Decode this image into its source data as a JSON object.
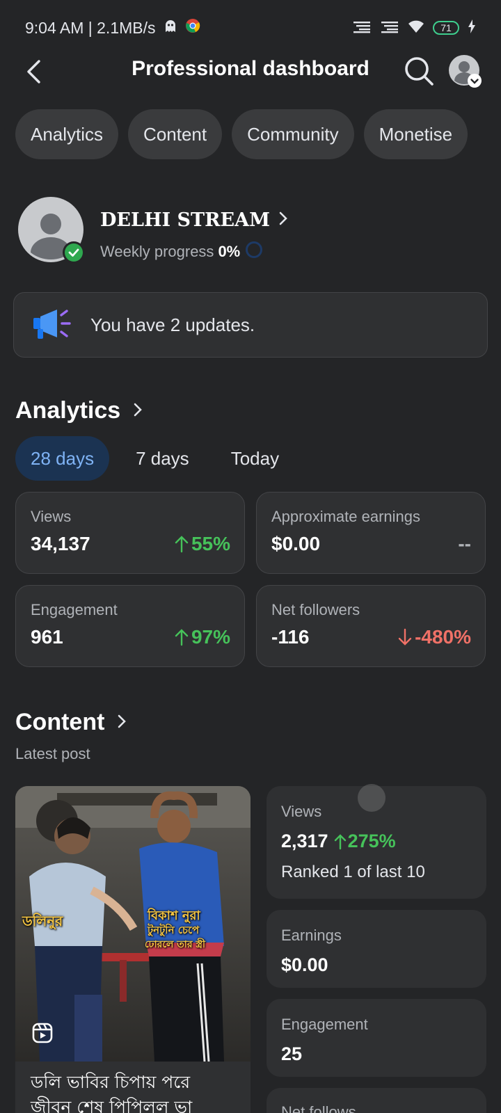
{
  "status_bar": {
    "time": "9:04 AM | 2.1MB/s",
    "battery": "71"
  },
  "header": {
    "title": "Professional dashboard"
  },
  "tabs": [
    "Analytics",
    "Content",
    "Community",
    "Monetise"
  ],
  "profile": {
    "name": "DELHI STREAM",
    "progress_label": "Weekly progress",
    "progress_value": "0%",
    "progress_fraction": 0
  },
  "updates": {
    "text": "You have 2 updates."
  },
  "analytics": {
    "title": "Analytics",
    "ranges": [
      "28 days",
      "7 days",
      "Today"
    ],
    "selected_range": "28 days",
    "cards": [
      {
        "label": "Views",
        "value": "34,137",
        "delta": "55%",
        "direction": "up"
      },
      {
        "label": "Approximate earnings",
        "value": "$0.00",
        "delta": "--",
        "direction": "none"
      },
      {
        "label": "Engagement",
        "value": "961",
        "delta": "97%",
        "direction": "up"
      },
      {
        "label": "Net followers",
        "value": "-116",
        "delta": "-480%",
        "direction": "down"
      }
    ]
  },
  "content": {
    "title": "Content",
    "subtitle": "Latest post",
    "post": {
      "overlay_left": "ডলিনুর",
      "overlay_right_1": "বিকাশ নুরা",
      "overlay_right_2": "টুনটুনি চেপে",
      "overlay_right_3": "ঢোরলে তার স্ত্রী",
      "caption_line1": "ডলি ভাবির চিপায় পরে",
      "caption_line2": "জীবন শেষ পিপিলল ভা"
    },
    "stats": {
      "views_label": "Views",
      "views_value": "2,317",
      "views_delta": "275%",
      "views_rank": "Ranked 1 of last 10",
      "earnings_label": "Earnings",
      "earnings_value": "$0.00",
      "engagement_label": "Engagement",
      "engagement_value": "25",
      "followers_label": "Net follows"
    }
  },
  "colors": {
    "background": "#242527",
    "card": "#2f3032",
    "up": "#46c25a",
    "down": "#f07167",
    "accent": "#7fb3f5"
  }
}
